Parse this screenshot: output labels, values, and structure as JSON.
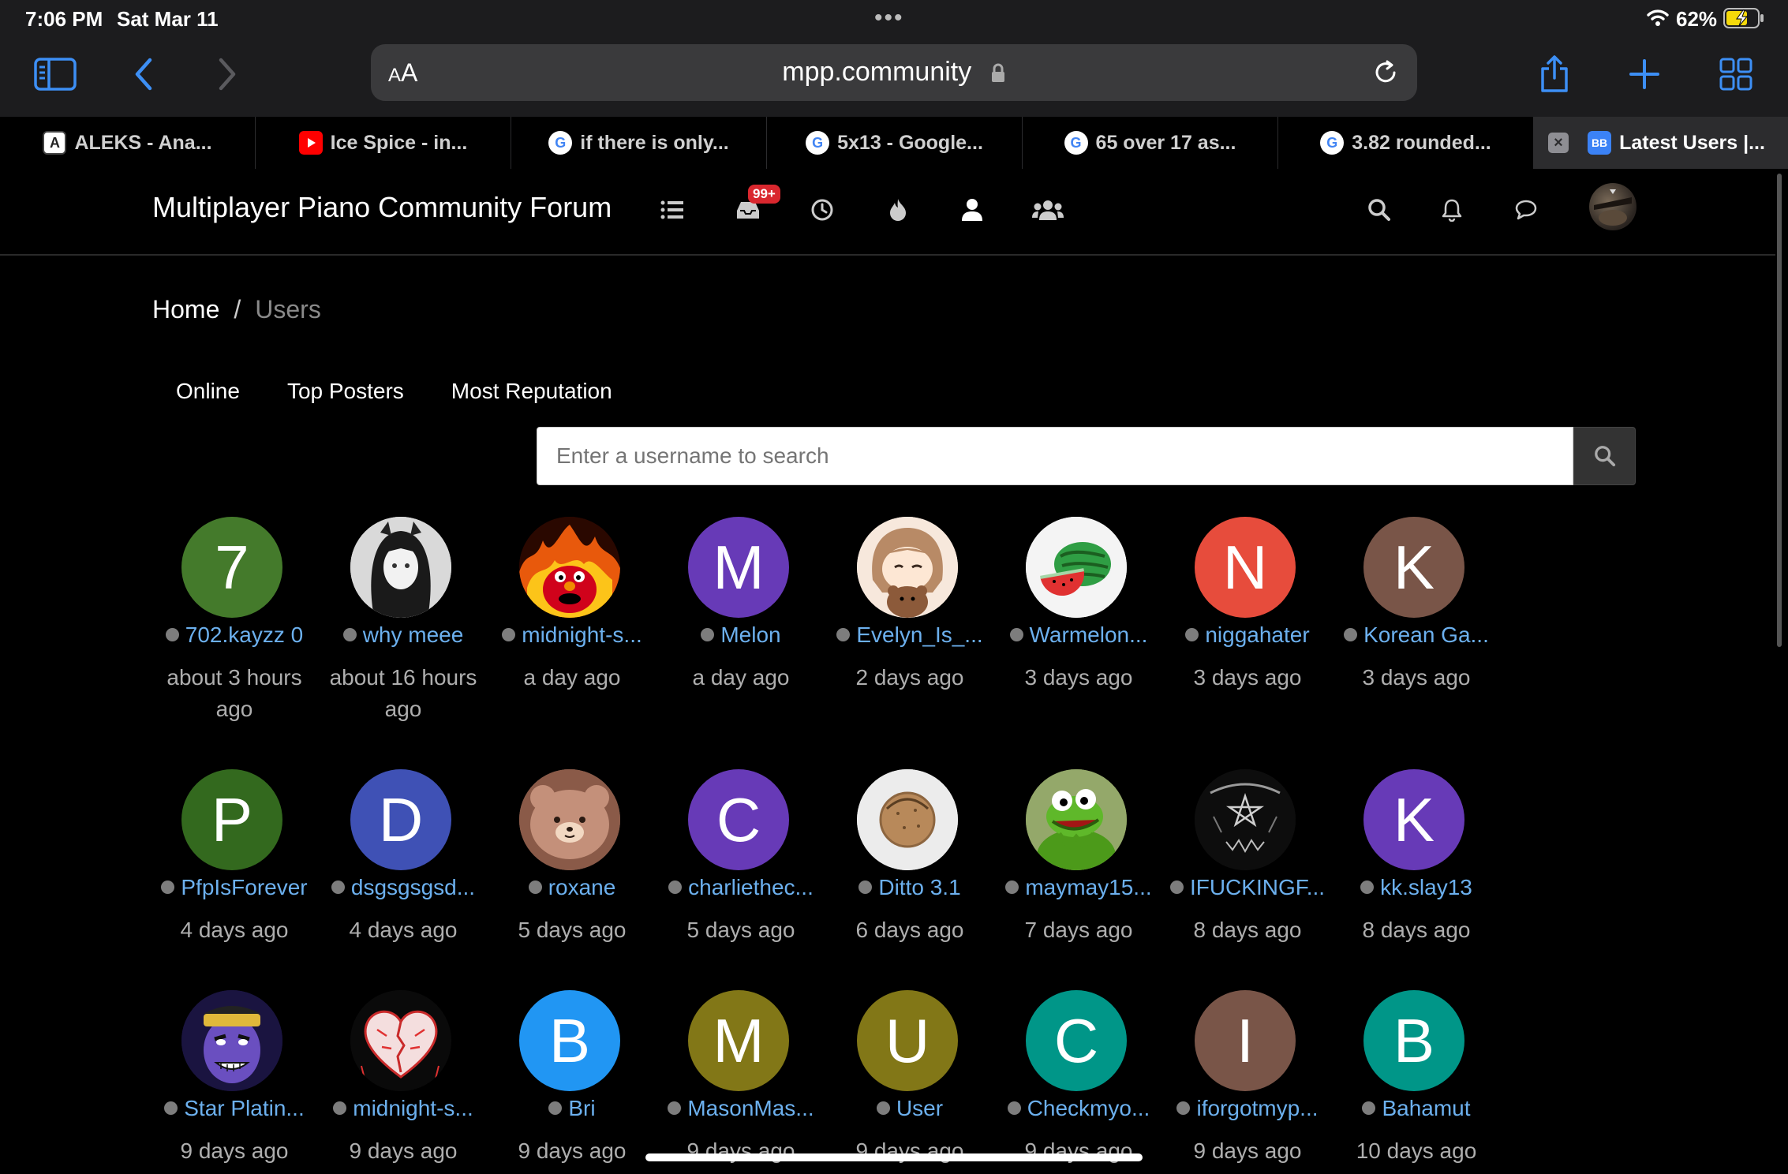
{
  "status_bar": {
    "time": "7:06 PM",
    "date": "Sat Mar 11",
    "battery": "62%"
  },
  "browser": {
    "url_aa": "AA",
    "url": "mpp.community",
    "tabs": [
      {
        "title": "ALEKS - Ana...",
        "favicon": "A"
      },
      {
        "title": "Ice Spice - in...",
        "favicon": "youtube"
      },
      {
        "title": "if there is only...",
        "favicon": "G"
      },
      {
        "title": "5x13 - Google...",
        "favicon": "G"
      },
      {
        "title": "65 over 17 as...",
        "favicon": "G"
      },
      {
        "title": "3.82 rounded...",
        "favicon": "G"
      },
      {
        "title": "Latest Users |...",
        "favicon": "nodebb",
        "active": true
      }
    ]
  },
  "forum": {
    "brand": "Multiplayer Piano Community Forum",
    "unread_badge": "99+",
    "breadcrumb": {
      "home": "Home",
      "separator": "/",
      "current": "Users"
    },
    "filters": [
      "Online",
      "Top Posters",
      "Most Reputation"
    ],
    "search": {
      "placeholder": "Enter a username to search"
    }
  },
  "users": [
    {
      "name": "702.kayzz 0",
      "time": "about 3 hours ago",
      "letter": "7",
      "color": "#447a2b"
    },
    {
      "name": "why meee",
      "time": "about 16 hours ago",
      "image": "grayscale-girl"
    },
    {
      "name": "midnight-s...",
      "time": "a day ago",
      "image": "fire-elmo"
    },
    {
      "name": "Melon",
      "time": "a day ago",
      "letter": "M",
      "color": "#673ab7"
    },
    {
      "name": "Evelyn_Is_...",
      "time": "2 days ago",
      "image": "anime-bear"
    },
    {
      "name": "Warmelon...",
      "time": "3 days ago",
      "image": "watermelon"
    },
    {
      "name": "niggahater",
      "time": "3 days ago",
      "letter": "N",
      "color": "#e74c3c"
    },
    {
      "name": "Korean Ga...",
      "time": "3 days ago",
      "letter": "K",
      "color": "#795548"
    },
    {
      "name": "PfpIsForever",
      "time": "4 days ago",
      "letter": "P",
      "color": "#33691e"
    },
    {
      "name": "dsgsgsgsd...",
      "time": "4 days ago",
      "letter": "D",
      "color": "#3f51b5"
    },
    {
      "name": "roxane",
      "time": "5 days ago",
      "image": "rilakkuma"
    },
    {
      "name": "charliethec...",
      "time": "5 days ago",
      "letter": "C",
      "color": "#673ab7"
    },
    {
      "name": "Ditto 3.1",
      "time": "6 days ago",
      "image": "cookie"
    },
    {
      "name": "maymay15...",
      "time": "7 days ago",
      "image": "kermit"
    },
    {
      "name": "IFUCKINGF...",
      "time": "8 days ago",
      "image": "black-metal"
    },
    {
      "name": "kk.slay13",
      "time": "8 days ago",
      "letter": "K",
      "color": "#673ab7"
    },
    {
      "name": "Star Platin...",
      "time": "9 days ago",
      "image": "star-platinum"
    },
    {
      "name": "midnight-s...",
      "time": "9 days ago",
      "image": "red-heart"
    },
    {
      "name": "Bri",
      "time": "9 days ago",
      "letter": "B",
      "color": "#2196f3"
    },
    {
      "name": "MasonMas...",
      "time": "9 days ago",
      "letter": "M",
      "color": "#827717"
    },
    {
      "name": "User",
      "time": "9 days ago",
      "letter": "U",
      "color": "#827717"
    },
    {
      "name": "Checkmyo...",
      "time": "9 days ago",
      "letter": "C",
      "color": "#009688"
    },
    {
      "name": "iforgotmyp...",
      "time": "9 days ago",
      "letter": "I",
      "color": "#795548"
    },
    {
      "name": "Bahamut",
      "time": "10 days ago",
      "letter": "B",
      "color": "#009688"
    }
  ]
}
